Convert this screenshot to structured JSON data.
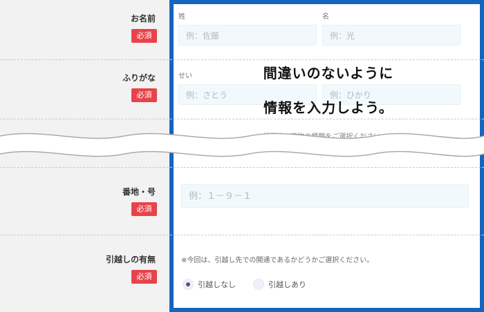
{
  "form": {
    "required_badge": "必須",
    "name": {
      "label": "お名前",
      "last_label": "姓",
      "first_label": "名",
      "last_placeholder": "例：佐藤",
      "first_placeholder": "例：光"
    },
    "furigana": {
      "label": "ふりがな",
      "last_label": "せい",
      "last_placeholder": "例：さとう",
      "first_placeholder": "例：ひかり"
    },
    "building_hint": "※設置先の建物の種類をご選択ください",
    "address": {
      "label": "番地・号",
      "placeholder": "例：１－９－１"
    },
    "moving": {
      "label": "引越しの有無",
      "notice": "※今回は、引越し先での開通であるかどうかご選択ください。",
      "options": [
        {
          "label": "引越しなし",
          "selected": true
        },
        {
          "label": "引越しあり",
          "selected": false
        }
      ]
    }
  },
  "overlay": {
    "line1": "間違いのないように",
    "line2": "情報を入力しよう。"
  },
  "colors": {
    "frame": "#1565c0",
    "badge": "#e8434a",
    "input_bg": "#f2f9fc"
  }
}
